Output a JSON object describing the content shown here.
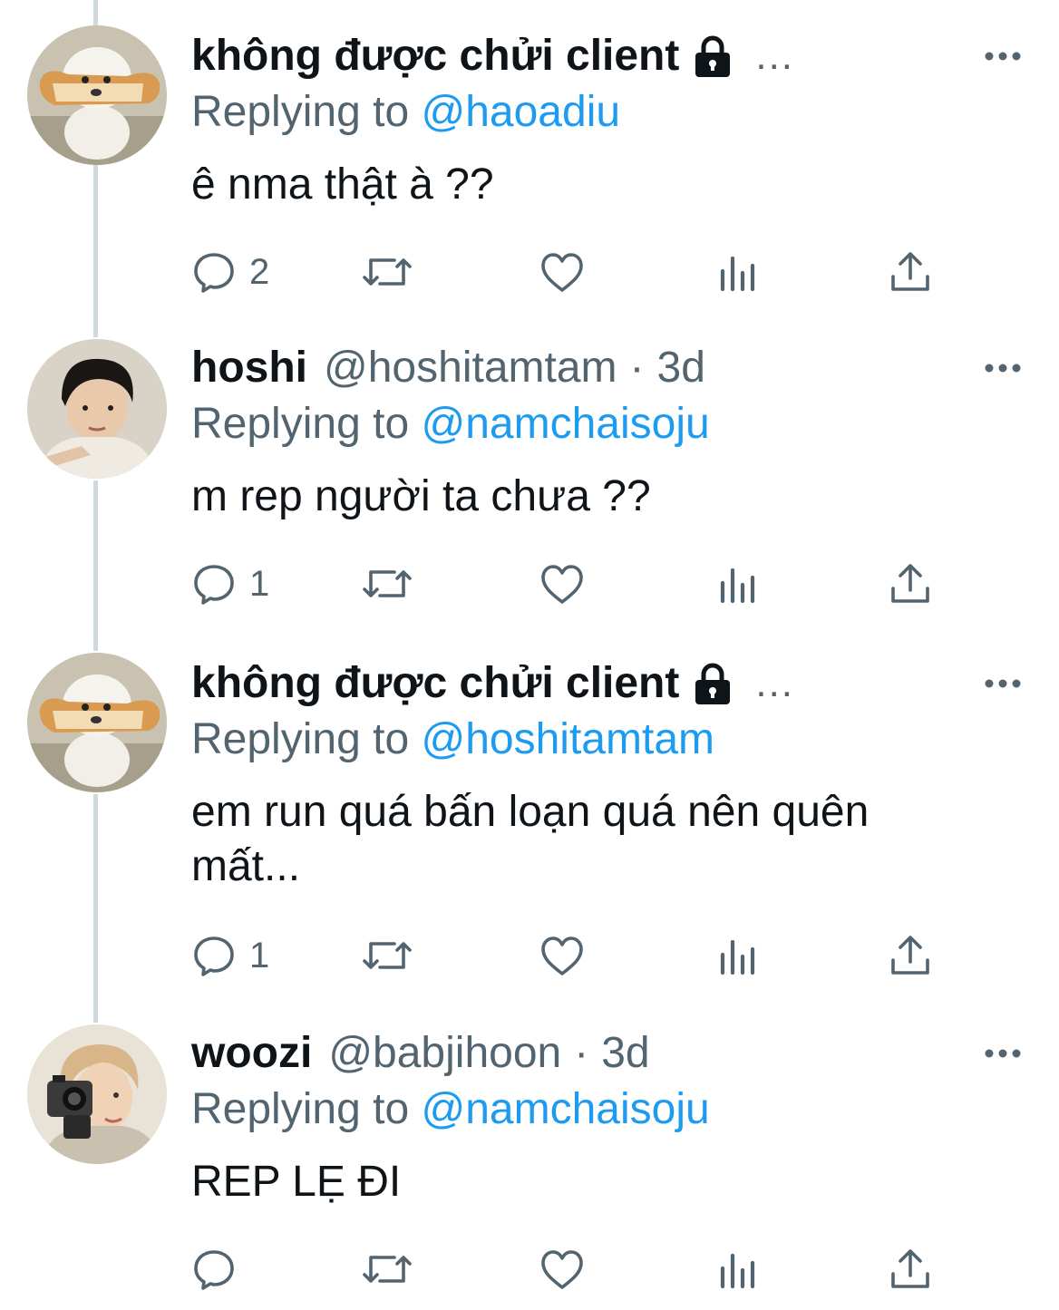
{
  "colors": {
    "text": "#0f1419",
    "secondary": "#536471",
    "mention": "#1d9bf0",
    "thread_line": "#cfd9de"
  },
  "tweets": [
    {
      "name": "không được chửi client",
      "protected": true,
      "handle": "",
      "time": "",
      "truncated": "...",
      "replying_prefix": "Replying to",
      "replying_to": "@haoadiu",
      "text": "ê nma thật à ??",
      "reply_count": "2",
      "avatar": "white-puppy-bread-avatar"
    },
    {
      "name": "hoshi",
      "protected": false,
      "handle": "@hoshitamtam",
      "sep": "·",
      "time": "3d",
      "replying_prefix": "Replying to",
      "replying_to": "@namchaisoju",
      "text": "m rep người ta chưa ??",
      "reply_count": "1",
      "avatar": "man-portrait-avatar"
    },
    {
      "name": "không được chửi client",
      "protected": true,
      "handle": "",
      "time": "",
      "truncated": "...",
      "replying_prefix": "Replying to",
      "replying_to": "@hoshitamtam",
      "text": "em run quá bấn loạn quá nên quên mất...",
      "reply_count": "1",
      "avatar": "white-puppy-bread-avatar"
    },
    {
      "name": "woozi",
      "protected": false,
      "handle": "@babjihoon",
      "sep": "·",
      "time": "3d",
      "replying_prefix": "Replying to",
      "replying_to": "@namchaisoju",
      "text": "REP LẸ ĐI",
      "reply_count": "",
      "avatar": "man-with-camera-avatar"
    }
  ]
}
